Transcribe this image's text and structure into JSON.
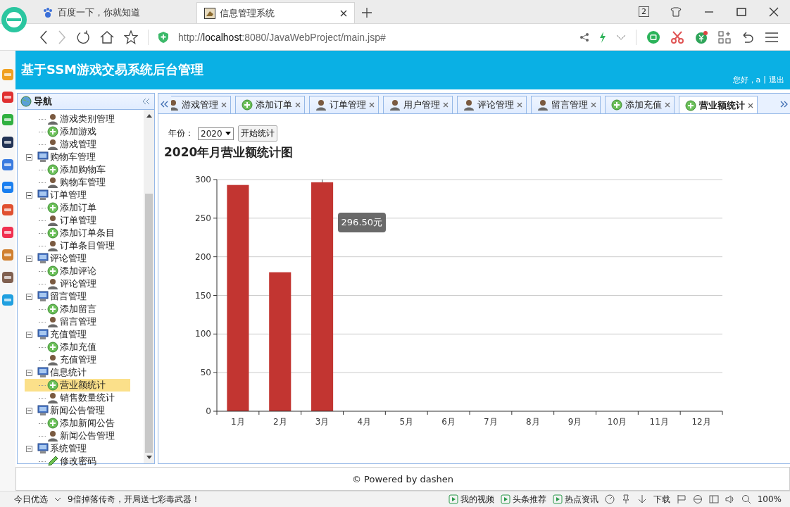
{
  "browser": {
    "tabs": [
      {
        "title": "百度一下，你就知道",
        "selected": false,
        "kind": "baidu"
      },
      {
        "title": "信息管理系统",
        "selected": true,
        "kind": "app"
      }
    ],
    "tab_count": "2",
    "url": "http://**localhost**:8080/JavaWebProject/main.jsp#"
  },
  "header": {
    "title": "基于SSM游戏交易系统后台管理",
    "greeting": "您好，a",
    "separator": "|",
    "logout": "退出"
  },
  "nav": {
    "title": "导航",
    "tree": [
      {
        "children": [
          {
            "label": "游戏类别管理",
            "kind": "user",
            "selected": false
          },
          {
            "label": "添加游戏",
            "kind": "add",
            "selected": false
          },
          {
            "label": "游戏管理",
            "kind": "user",
            "selected": false
          }
        ]
      },
      {
        "label": "购物车管理",
        "expanded": true,
        "children": [
          {
            "label": "添加购物车",
            "kind": "add",
            "selected": false
          },
          {
            "label": "购物车管理",
            "kind": "user",
            "selected": false
          }
        ]
      },
      {
        "label": "订单管理",
        "expanded": true,
        "children": [
          {
            "label": "添加订单",
            "kind": "add",
            "selected": false
          },
          {
            "label": "订单管理",
            "kind": "user",
            "selected": false
          },
          {
            "label": "添加订单条目",
            "kind": "add",
            "selected": false
          },
          {
            "label": "订单条目管理",
            "kind": "user",
            "selected": false
          }
        ]
      },
      {
        "label": "评论管理",
        "expanded": true,
        "children": [
          {
            "label": "添加评论",
            "kind": "add",
            "selected": false
          },
          {
            "label": "评论管理",
            "kind": "user",
            "selected": false
          }
        ]
      },
      {
        "label": "留言管理",
        "expanded": true,
        "children": [
          {
            "label": "添加留言",
            "kind": "add",
            "selected": false
          },
          {
            "label": "留言管理",
            "kind": "user",
            "selected": false
          }
        ]
      },
      {
        "label": "充值管理",
        "expanded": true,
        "children": [
          {
            "label": "添加充值",
            "kind": "add",
            "selected": false
          },
          {
            "label": "充值管理",
            "kind": "user",
            "selected": false
          }
        ]
      },
      {
        "label": "信息统计",
        "expanded": true,
        "children": [
          {
            "label": "营业额统计",
            "kind": "add",
            "selected": true
          },
          {
            "label": "销售数量统计",
            "kind": "user",
            "selected": false
          }
        ]
      },
      {
        "label": "新闻公告管理",
        "expanded": true,
        "children": [
          {
            "label": "添加新闻公告",
            "kind": "add",
            "selected": false
          },
          {
            "label": "新闻公告管理",
            "kind": "user",
            "selected": false
          }
        ]
      },
      {
        "label": "系统管理",
        "expanded": true,
        "children": [
          {
            "label": "修改密码",
            "kind": "pencil",
            "selected": false
          }
        ]
      }
    ]
  },
  "tabs": [
    {
      "label": "游戏管理",
      "kind": "user",
      "selected": false
    },
    {
      "label": "添加订单",
      "kind": "add",
      "selected": false
    },
    {
      "label": "订单管理",
      "kind": "user",
      "selected": false
    },
    {
      "label": "用户管理",
      "kind": "user",
      "selected": false
    },
    {
      "label": "评论管理",
      "kind": "user",
      "selected": false
    },
    {
      "label": "留言管理",
      "kind": "user",
      "selected": false
    },
    {
      "label": "添加充值",
      "kind": "add",
      "selected": false
    },
    {
      "label": "营业额统计",
      "kind": "add",
      "selected": true
    }
  ],
  "toolbar": {
    "year_label": "年份：",
    "year": "2020",
    "button": "开始统计"
  },
  "report": {
    "title": "2020年月营业额统计图",
    "chart_data": {
      "type": "bar",
      "categories": [
        "1月",
        "2月",
        "3月",
        "4月",
        "5月",
        "6月",
        "7月",
        "8月",
        "9月",
        "10月",
        "11月",
        "12月"
      ],
      "series": [
        {
          "color": "#c23531",
          "values": [
            293,
            180,
            296.5,
            0,
            0,
            0,
            0,
            0,
            0,
            0,
            0,
            0
          ]
        }
      ],
      "ylim": [
        0,
        300
      ],
      "yticks": [
        0,
        50,
        100,
        150,
        200,
        250,
        300
      ],
      "grid": true,
      "ref_lines": [
        {
          "axis": "x",
          "value": "3月"
        }
      ],
      "annotations": [
        "296.50元"
      ]
    }
  },
  "footer": "© Powered by dashen",
  "status_bar": {
    "left": "今日优选",
    "news": "9倍掉落传奇，开局送七彩毒武器！",
    "items": [
      "我的视频",
      "头条推荐",
      "热点资讯"
    ],
    "download": "下载",
    "zoom": "100%"
  }
}
